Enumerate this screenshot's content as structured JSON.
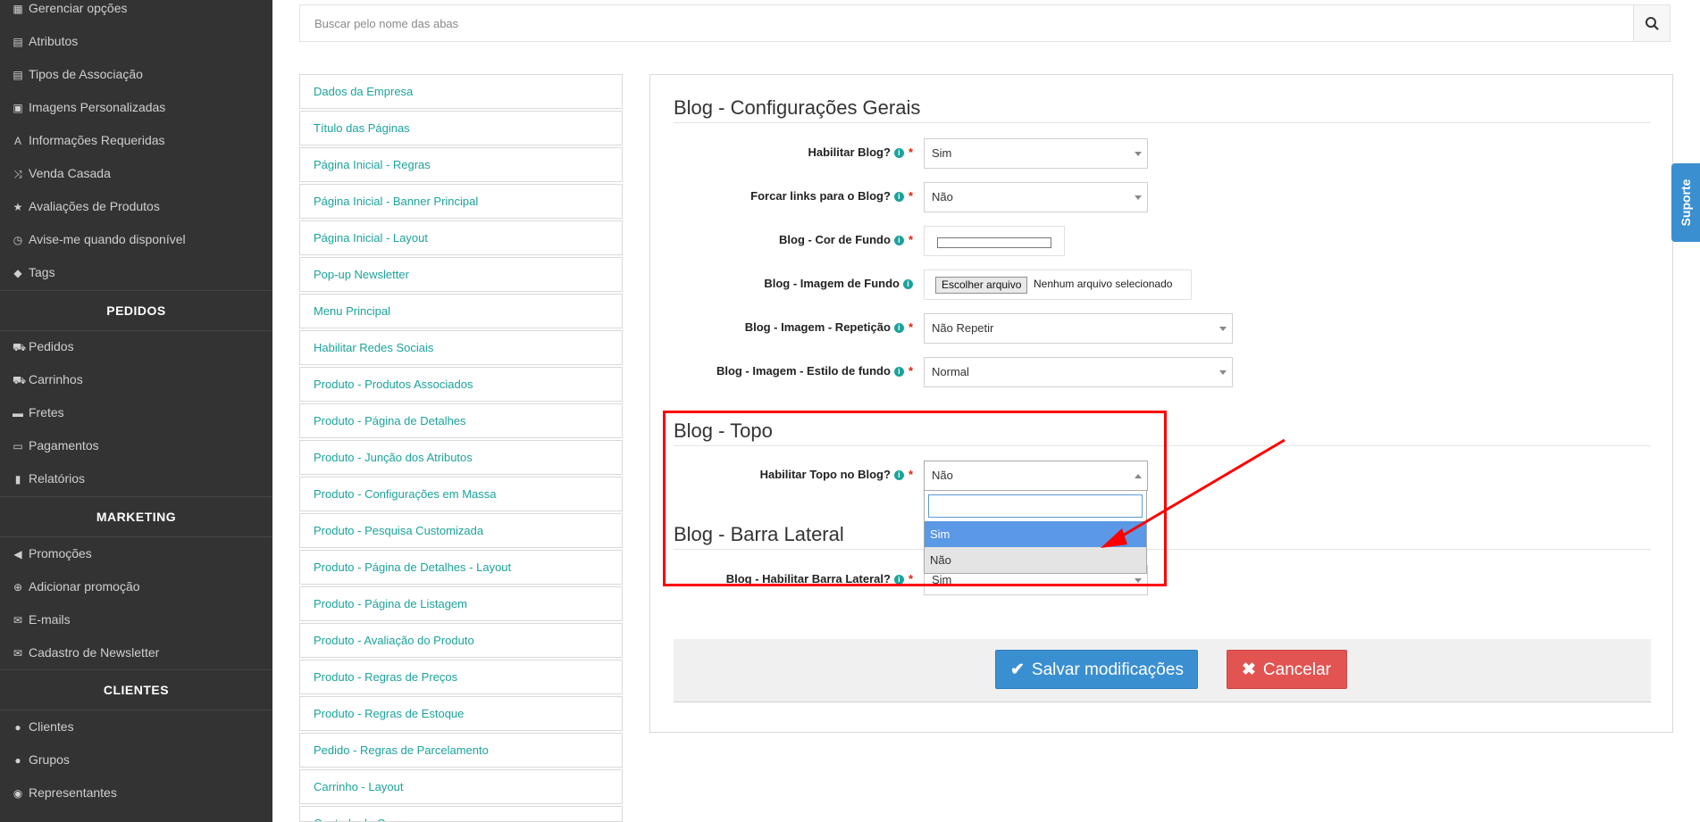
{
  "sidebar": {
    "items_top": [
      {
        "label": "Gerenciar opções",
        "icon": "grid-icon"
      },
      {
        "label": "Atributos",
        "icon": "list-icon"
      },
      {
        "label": "Tipos de Associação",
        "icon": "list-icon"
      },
      {
        "label": "Imagens Personalizadas",
        "icon": "image-icon"
      },
      {
        "label": "Informações Requeridas",
        "icon": "font-icon"
      },
      {
        "label": "Venda Casada",
        "icon": "shuffle-icon"
      },
      {
        "label": "Avaliações de Produtos",
        "icon": "star-icon"
      },
      {
        "label": "Avise-me quando disponível",
        "icon": "clock-icon"
      },
      {
        "label": "Tags",
        "icon": "tag-icon"
      }
    ],
    "pedidos_title": "PEDIDOS",
    "items_pedidos": [
      {
        "label": "Pedidos",
        "icon": "cart-icon"
      },
      {
        "label": "Carrinhos",
        "icon": "cart-icon"
      },
      {
        "label": "Fretes",
        "icon": "truck-icon"
      },
      {
        "label": "Pagamentos",
        "icon": "credit-card-icon"
      },
      {
        "label": "Relatórios",
        "icon": "bar-chart-icon"
      }
    ],
    "marketing_title": "MARKETING",
    "items_marketing": [
      {
        "label": "Promoções",
        "icon": "bullhorn-icon"
      },
      {
        "label": "Adicionar promoção",
        "icon": "plus-circle-icon"
      },
      {
        "label": "E-mails",
        "icon": "envelope-icon"
      },
      {
        "label": "Cadastro de Newsletter",
        "icon": "envelope-icon"
      }
    ],
    "clientes_title": "CLIENTES",
    "items_clientes": [
      {
        "label": "Clientes",
        "icon": "user-icon"
      },
      {
        "label": "Grupos",
        "icon": "users-icon"
      },
      {
        "label": "Representantes",
        "icon": "user-circle-icon"
      }
    ]
  },
  "search": {
    "placeholder": "Buscar pelo nome das abas"
  },
  "tabs": [
    "Dados da Empresa",
    "Título das Páginas",
    "Página Inicial - Regras",
    "Página Inicial - Banner Principal",
    "Página Inicial - Layout",
    "Pop-up Newsletter",
    "Menu Principal",
    "Habilitar Redes Sociais",
    "Produto - Produtos Associados",
    "Produto - Página de Detalhes",
    "Produto - Junção dos Atributos",
    "Produto - Configurações em Massa",
    "Produto - Pesquisa Customizada",
    "Produto - Página de Detalhes - Layout",
    "Produto - Página de Listagem",
    "Produto - Avaliação do Produto",
    "Produto - Regras de Preços",
    "Produto - Regras de Estoque",
    "Pedido - Regras de Parcelamento",
    "Carrinho - Layout",
    "Controle de Ca..."
  ],
  "sections": {
    "general": "Blog - Configurações Gerais",
    "topo": "Blog - Topo",
    "barra": "Blog - Barra Lateral"
  },
  "fields": {
    "habilitar_blog": {
      "label": "Habilitar Blog?",
      "value": "Sim"
    },
    "forcar_links": {
      "label": "Forcar links para o Blog?",
      "value": "Não"
    },
    "cor_fundo": {
      "label": "Blog - Cor de Fundo",
      "value": "#ffffff"
    },
    "imagem_fundo": {
      "label": "Blog - Imagem de Fundo",
      "button": "Escolher arquivo",
      "file_status": "Nenhum arquivo selecionado"
    },
    "imagem_repeticao": {
      "label": "Blog - Imagem - Repetição",
      "value": "Não Repetir"
    },
    "imagem_estilo": {
      "label": "Blog - Imagem - Estilo de fundo",
      "value": "Normal"
    },
    "habilitar_topo": {
      "label": "Habilitar Topo no Blog?",
      "value": "Não",
      "options": [
        "Sim",
        "Não"
      ]
    },
    "habilitar_barra": {
      "label": "Blog - Habilitar Barra Lateral?",
      "value": "Sim"
    }
  },
  "required_mark": "*",
  "actions": {
    "save": "Salvar modificações",
    "cancel": "Cancelar"
  },
  "support_label": "Suporte",
  "colors": {
    "sidebar_bg": "#333333",
    "link": "#1ba39c",
    "primary": "#3a8fd1",
    "danger": "#e25451",
    "annotation": "#ff0000"
  }
}
